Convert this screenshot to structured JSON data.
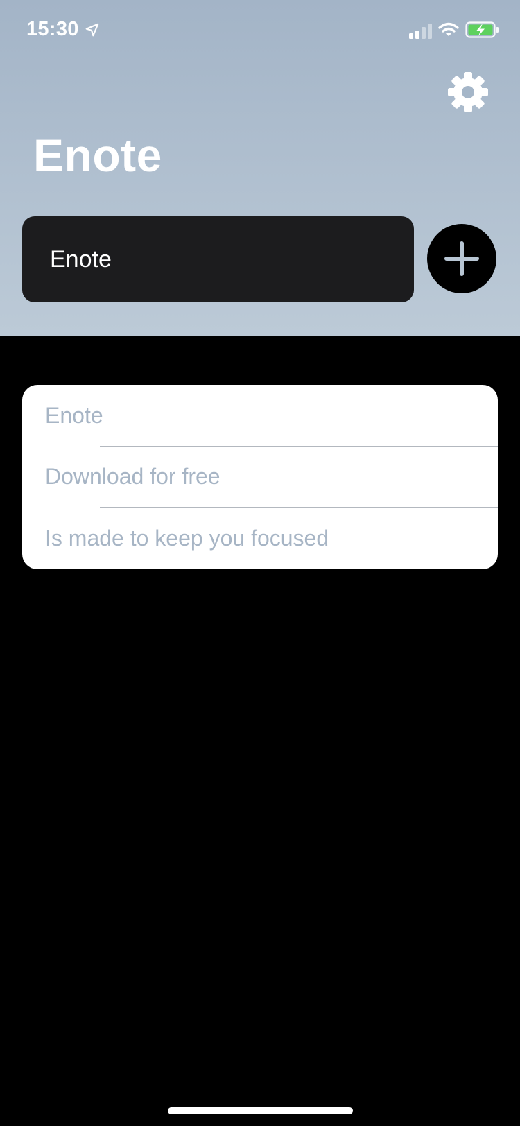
{
  "status_bar": {
    "time": "15:30"
  },
  "header": {
    "title": "Enote"
  },
  "input": {
    "value": "Enote"
  },
  "notes": [
    {
      "text": "Enote"
    },
    {
      "text": "Download for free"
    },
    {
      "text": "Is made to keep you focused"
    }
  ],
  "icons": {
    "settings": "gear-icon",
    "add": "plus-icon",
    "location": "location-arrow-icon",
    "signal": "cellular-signal-icon",
    "wifi": "wifi-icon",
    "battery": "battery-charging-icon"
  },
  "colors": {
    "header_top": "#a3b4c7",
    "header_bottom": "#bccad7",
    "note_text": "#a7b5c5",
    "battery_fill": "#5ed15e"
  }
}
